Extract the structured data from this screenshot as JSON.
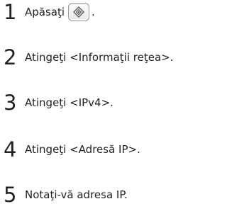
{
  "steps": [
    {
      "number": "1",
      "text": "Apăsaţi",
      "suffix": ".",
      "icon": "home-diamond-icon"
    },
    {
      "number": "2",
      "text": "Atingeţi <Informaţii reţea>."
    },
    {
      "number": "3",
      "text": "Atingeţi <IPv4>."
    },
    {
      "number": "4",
      "text": "Atingeţi <Adresă IP>."
    },
    {
      "number": "5",
      "text": "Notaţi-vă adresa IP."
    }
  ]
}
